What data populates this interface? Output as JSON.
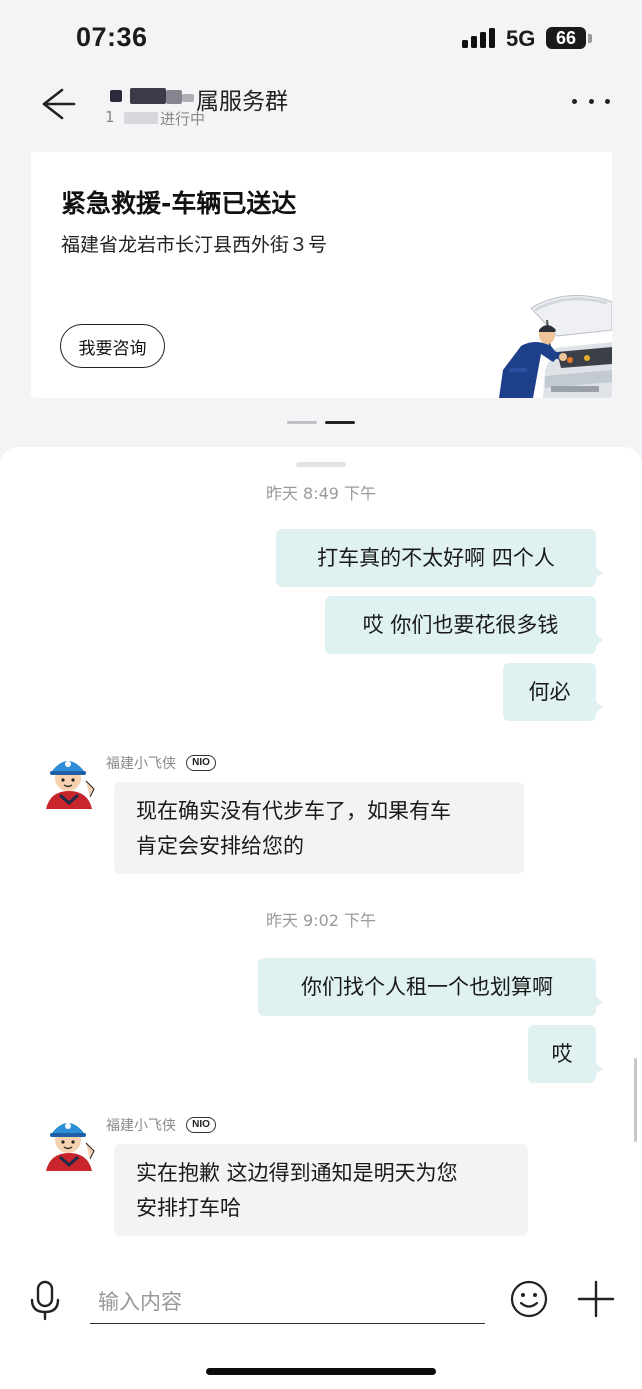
{
  "status_bar": {
    "time": "07:36",
    "network": "5G",
    "battery": "66"
  },
  "header": {
    "title": "属服务群",
    "subtitle_prefix": "1",
    "subtitle_status": "进行中",
    "back_icon": "arrow-left-icon",
    "more_icon": "more-horizontal-icon"
  },
  "service_card": {
    "title": "紧急救援-车辆已送达",
    "address": "福建省龙岩市长汀县西外街３号",
    "consult_button": "我要咨询",
    "illustration": "mechanic-under-car-hood"
  },
  "pager": {
    "pages": 2,
    "active_index": 1
  },
  "chat": {
    "messages": [
      {
        "type": "timestamp",
        "text": "昨天 8:49 下午"
      },
      {
        "type": "outgoing",
        "text": "打车真的不太好啊 四个人"
      },
      {
        "type": "outgoing",
        "text": "哎 你们也要花很多钱"
      },
      {
        "type": "outgoing",
        "text": "何必"
      },
      {
        "type": "incoming",
        "sender": "福建小飞侠",
        "badge": "NIO",
        "lines": [
          "现在确实没有代步车了，如果有车",
          "肯定会安排给您的"
        ]
      },
      {
        "type": "timestamp",
        "text": "昨天 9:02 下午"
      },
      {
        "type": "outgoing",
        "text": "你们找个人租一个也划算啊"
      },
      {
        "type": "outgoing",
        "text": "哎"
      },
      {
        "type": "incoming",
        "sender": "福建小飞侠",
        "badge": "NIO",
        "lines": [
          "实在抱歉 这边得到通知是明天为您",
          "安排打车哈"
        ]
      }
    ]
  },
  "input_bar": {
    "placeholder": "输入内容",
    "mic_icon": "microphone-icon",
    "emoji_icon": "smiley-icon",
    "plus_icon": "plus-icon"
  },
  "colors": {
    "outgoing_bubble": "#dff1f0",
    "incoming_bubble": "#f3f3f5",
    "page_background": "#f4f4f6"
  }
}
